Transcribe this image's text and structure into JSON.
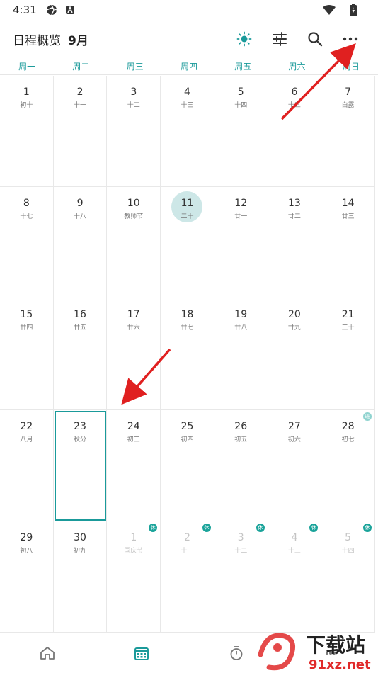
{
  "status": {
    "time": "4:31"
  },
  "appbar": {
    "title": "日程概览",
    "month": "9月",
    "icons": [
      "brightness-icon",
      "filter-sliders-icon",
      "search-icon",
      "more-icon"
    ]
  },
  "weekdays": [
    "周一",
    "周二",
    "周三",
    "周四",
    "周五",
    "周六",
    "周日"
  ],
  "days": [
    {
      "n": "1",
      "l": "初十"
    },
    {
      "n": "2",
      "l": "十一"
    },
    {
      "n": "3",
      "l": "十二"
    },
    {
      "n": "4",
      "l": "十三"
    },
    {
      "n": "5",
      "l": "十四"
    },
    {
      "n": "6",
      "l": "十五"
    },
    {
      "n": "7",
      "l": "白露"
    },
    {
      "n": "8",
      "l": "十七"
    },
    {
      "n": "9",
      "l": "十八"
    },
    {
      "n": "10",
      "l": "教师节"
    },
    {
      "n": "11",
      "l": "二十",
      "today": true
    },
    {
      "n": "12",
      "l": "廿一"
    },
    {
      "n": "13",
      "l": "廿二"
    },
    {
      "n": "14",
      "l": "廿三"
    },
    {
      "n": "15",
      "l": "廿四"
    },
    {
      "n": "16",
      "l": "廿五"
    },
    {
      "n": "17",
      "l": "廿六"
    },
    {
      "n": "18",
      "l": "廿七"
    },
    {
      "n": "19",
      "l": "廿八"
    },
    {
      "n": "20",
      "l": "廿九"
    },
    {
      "n": "21",
      "l": "三十"
    },
    {
      "n": "22",
      "l": "八月"
    },
    {
      "n": "23",
      "l": "秋分",
      "selected": true
    },
    {
      "n": "24",
      "l": "初三"
    },
    {
      "n": "25",
      "l": "初四"
    },
    {
      "n": "26",
      "l": "初五"
    },
    {
      "n": "27",
      "l": "初六"
    },
    {
      "n": "28",
      "l": "初七",
      "badge": "班",
      "badge_light": true
    },
    {
      "n": "29",
      "l": "初八"
    },
    {
      "n": "30",
      "l": "初九"
    },
    {
      "n": "1",
      "l": "国庆节",
      "other": true,
      "badge": "休"
    },
    {
      "n": "2",
      "l": "十一",
      "other": true,
      "badge": "休"
    },
    {
      "n": "3",
      "l": "十二",
      "other": true,
      "badge": "休"
    },
    {
      "n": "4",
      "l": "十三",
      "other": true,
      "badge": "休"
    },
    {
      "n": "5",
      "l": "十四",
      "other": true,
      "badge": "休"
    }
  ],
  "bottom_nav": [
    "home-icon",
    "calendar-icon",
    "timer-icon",
    "more-icon"
  ],
  "colors": {
    "accent": "#1a9a9a",
    "today_bg": "#cde7e7",
    "annotation": "#e02020"
  },
  "watermark": {
    "text": "下载站",
    "url": "91xz.net"
  }
}
